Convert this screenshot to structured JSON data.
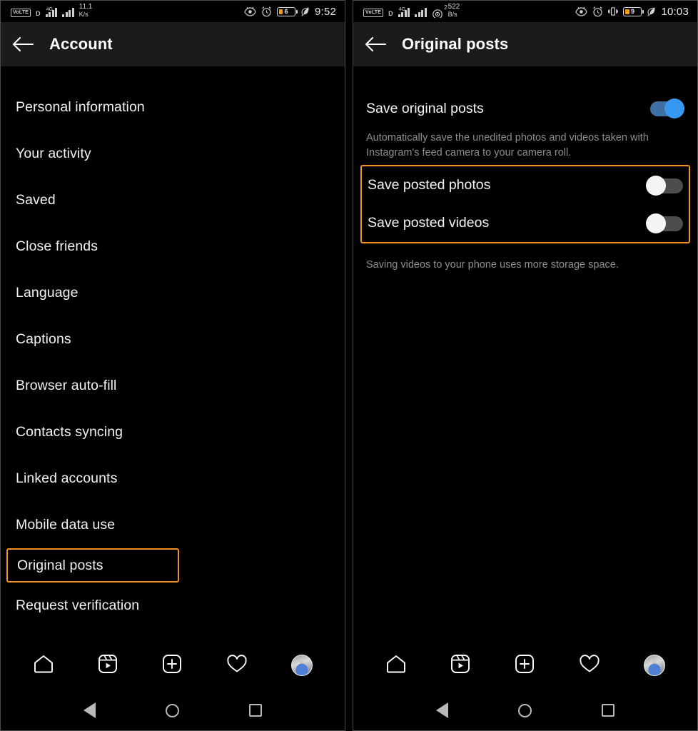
{
  "left_phone": {
    "status_bar": {
      "volte_label": "VoLTE",
      "sim_label": "D",
      "network_label": "4G",
      "speed_value": "11.1",
      "speed_unit": "K/s",
      "battery_percent": "6",
      "clock": "9:52",
      "icons": [
        "volte-badge",
        "sim-indicator",
        "signal-bars-4g",
        "signal-bars-2",
        "eye-icon",
        "alarm-icon",
        "battery-icon",
        "leaf-icon"
      ]
    },
    "app_bar": {
      "back_icon": "back-arrow-icon",
      "title": "Account"
    },
    "menu": {
      "items": [
        {
          "label": "Personal information",
          "highlighted": false
        },
        {
          "label": "Your activity",
          "highlighted": false
        },
        {
          "label": "Saved",
          "highlighted": false
        },
        {
          "label": "Close friends",
          "highlighted": false
        },
        {
          "label": "Language",
          "highlighted": false
        },
        {
          "label": "Captions",
          "highlighted": false
        },
        {
          "label": "Browser auto-fill",
          "highlighted": false
        },
        {
          "label": "Contacts syncing",
          "highlighted": false
        },
        {
          "label": "Linked accounts",
          "highlighted": false
        },
        {
          "label": "Mobile data use",
          "highlighted": false
        },
        {
          "label": "Original posts",
          "highlighted": true
        },
        {
          "label": "Request verification",
          "highlighted": false
        }
      ]
    },
    "app_nav": {
      "items": [
        "home-icon",
        "reels-icon",
        "create-post-icon",
        "activity-heart-icon",
        "profile-avatar"
      ]
    },
    "system_nav": {
      "items": [
        "android-back-button",
        "android-home-button",
        "android-recents-button"
      ]
    }
  },
  "right_phone": {
    "status_bar": {
      "volte_label": "VoLTE",
      "sim_label": "D",
      "network_label": "4G",
      "wifi_superscript": "2",
      "speed_value": "522",
      "speed_unit": "B/s",
      "battery_percent": "9",
      "clock": "10:03",
      "icons": [
        "volte-badge",
        "sim-indicator",
        "signal-bars-4g",
        "signal-bars-2",
        "wifi-icon",
        "eye-icon",
        "alarm-icon",
        "vibrate-icon",
        "battery-icon",
        "leaf-icon"
      ]
    },
    "app_bar": {
      "back_icon": "back-arrow-icon",
      "title": "Original posts"
    },
    "settings": {
      "primary": {
        "label": "Save original posts",
        "toggle_state": "on",
        "description": "Automatically save the unedited photos and videos taken with Instagram's feed camera to your camera roll."
      },
      "highlighted_group": {
        "rows": [
          {
            "label": "Save posted photos",
            "toggle_state": "off"
          },
          {
            "label": "Save posted videos",
            "toggle_state": "off"
          }
        ]
      },
      "footnote": "Saving videos to your phone uses more storage space."
    },
    "app_nav": {
      "items": [
        "home-icon",
        "reels-icon",
        "create-post-icon",
        "activity-heart-icon",
        "profile-avatar"
      ]
    },
    "system_nav": {
      "items": [
        "android-back-button",
        "android-home-button",
        "android-recents-button"
      ]
    }
  },
  "colors": {
    "highlight_orange": "#f0901e",
    "toggle_on_knob": "#3897f0",
    "toggle_on_track": "#3e6fa5",
    "toggle_off_track": "#4d4d4d",
    "toggle_off_knob": "#f5f5f5",
    "battery_orange": "#ff9800",
    "appbar_bg": "#1b1b1b",
    "screen_bg": "#000000",
    "text_primary": "#f2f2f2",
    "text_secondary": "#8e8e8e"
  }
}
